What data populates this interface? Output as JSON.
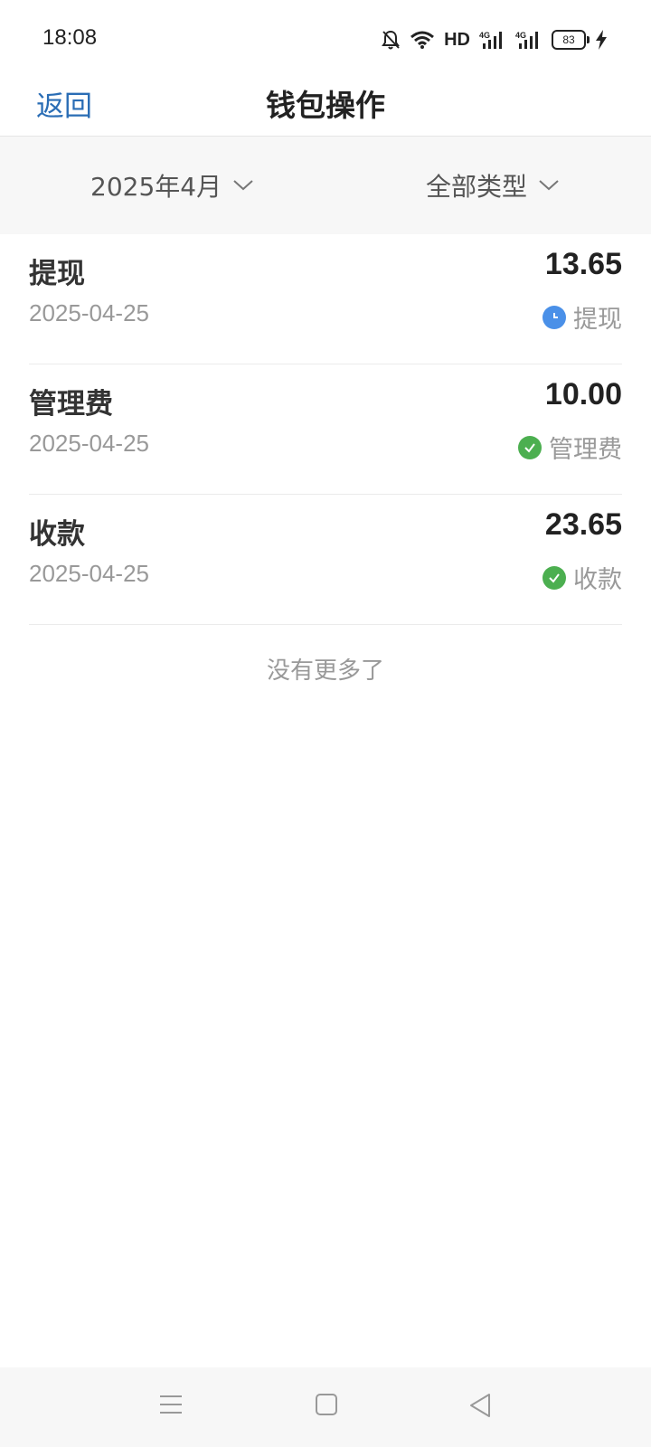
{
  "status_bar": {
    "time": "18:08",
    "network": "HD",
    "signal_label_1": "4G",
    "signal_label_2": "4G",
    "battery": "83",
    "icons": [
      "mute-bell-icon",
      "wifi-icon",
      "hd-icon",
      "signal-4g-icon",
      "signal-4g-icon",
      "battery-icon",
      "charging-icon"
    ]
  },
  "header": {
    "back_label": "返回",
    "title": "钱包操作"
  },
  "filters": {
    "month": "2025年4月",
    "type": "全部类型"
  },
  "transactions": [
    {
      "title": "提现",
      "date": "2025-04-25",
      "amount": "13.65",
      "status_label": "提现",
      "status_icon": "clock-icon",
      "status_color": "#4a90e8"
    },
    {
      "title": "管理费",
      "date": "2025-04-25",
      "amount": "10.00",
      "status_label": "管理费",
      "status_icon": "check-icon",
      "status_color": "#4caf50"
    },
    {
      "title": "收款",
      "date": "2025-04-25",
      "amount": "23.65",
      "status_label": "收款",
      "status_icon": "check-icon",
      "status_color": "#4caf50"
    }
  ],
  "list_footer": "没有更多了",
  "colors": {
    "accent": "#2a6db5",
    "pending": "#4a90e8",
    "success": "#4caf50"
  }
}
